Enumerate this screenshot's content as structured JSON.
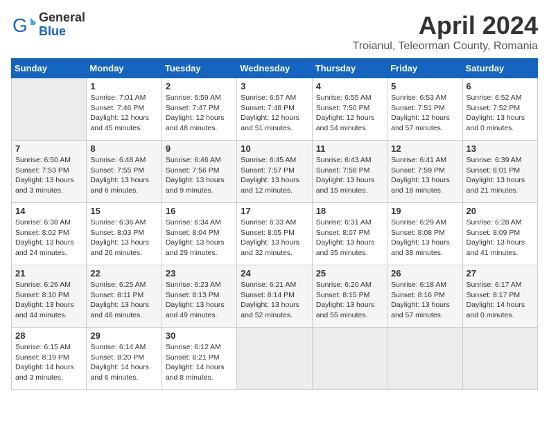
{
  "header": {
    "logo_general": "General",
    "logo_blue": "Blue",
    "month_year": "April 2024",
    "location": "Troianul, Teleorman County, Romania"
  },
  "weekdays": [
    "Sunday",
    "Monday",
    "Tuesday",
    "Wednesday",
    "Thursday",
    "Friday",
    "Saturday"
  ],
  "weeks": [
    [
      {
        "day": "",
        "info": ""
      },
      {
        "day": "1",
        "info": "Sunrise: 7:01 AM\nSunset: 7:46 PM\nDaylight: 12 hours\nand 45 minutes."
      },
      {
        "day": "2",
        "info": "Sunrise: 6:59 AM\nSunset: 7:47 PM\nDaylight: 12 hours\nand 48 minutes."
      },
      {
        "day": "3",
        "info": "Sunrise: 6:57 AM\nSunset: 7:48 PM\nDaylight: 12 hours\nand 51 minutes."
      },
      {
        "day": "4",
        "info": "Sunrise: 6:55 AM\nSunset: 7:50 PM\nDaylight: 12 hours\nand 54 minutes."
      },
      {
        "day": "5",
        "info": "Sunrise: 6:53 AM\nSunset: 7:51 PM\nDaylight: 12 hours\nand 57 minutes."
      },
      {
        "day": "6",
        "info": "Sunrise: 6:52 AM\nSunset: 7:52 PM\nDaylight: 13 hours\nand 0 minutes."
      }
    ],
    [
      {
        "day": "7",
        "info": "Sunrise: 6:50 AM\nSunset: 7:53 PM\nDaylight: 13 hours\nand 3 minutes."
      },
      {
        "day": "8",
        "info": "Sunrise: 6:48 AM\nSunset: 7:55 PM\nDaylight: 13 hours\nand 6 minutes."
      },
      {
        "day": "9",
        "info": "Sunrise: 6:46 AM\nSunset: 7:56 PM\nDaylight: 13 hours\nand 9 minutes."
      },
      {
        "day": "10",
        "info": "Sunrise: 6:45 AM\nSunset: 7:57 PM\nDaylight: 13 hours\nand 12 minutes."
      },
      {
        "day": "11",
        "info": "Sunrise: 6:43 AM\nSunset: 7:58 PM\nDaylight: 13 hours\nand 15 minutes."
      },
      {
        "day": "12",
        "info": "Sunrise: 6:41 AM\nSunset: 7:59 PM\nDaylight: 13 hours\nand 18 minutes."
      },
      {
        "day": "13",
        "info": "Sunrise: 6:39 AM\nSunset: 8:01 PM\nDaylight: 13 hours\nand 21 minutes."
      }
    ],
    [
      {
        "day": "14",
        "info": "Sunrise: 6:38 AM\nSunset: 8:02 PM\nDaylight: 13 hours\nand 24 minutes."
      },
      {
        "day": "15",
        "info": "Sunrise: 6:36 AM\nSunset: 8:03 PM\nDaylight: 13 hours\nand 26 minutes."
      },
      {
        "day": "16",
        "info": "Sunrise: 6:34 AM\nSunset: 8:04 PM\nDaylight: 13 hours\nand 29 minutes."
      },
      {
        "day": "17",
        "info": "Sunrise: 6:33 AM\nSunset: 8:05 PM\nDaylight: 13 hours\nand 32 minutes."
      },
      {
        "day": "18",
        "info": "Sunrise: 6:31 AM\nSunset: 8:07 PM\nDaylight: 13 hours\nand 35 minutes."
      },
      {
        "day": "19",
        "info": "Sunrise: 6:29 AM\nSunset: 8:08 PM\nDaylight: 13 hours\nand 38 minutes."
      },
      {
        "day": "20",
        "info": "Sunrise: 6:28 AM\nSunset: 8:09 PM\nDaylight: 13 hours\nand 41 minutes."
      }
    ],
    [
      {
        "day": "21",
        "info": "Sunrise: 6:26 AM\nSunset: 8:10 PM\nDaylight: 13 hours\nand 44 minutes."
      },
      {
        "day": "22",
        "info": "Sunrise: 6:25 AM\nSunset: 8:11 PM\nDaylight: 13 hours\nand 46 minutes."
      },
      {
        "day": "23",
        "info": "Sunrise: 6:23 AM\nSunset: 8:13 PM\nDaylight: 13 hours\nand 49 minutes."
      },
      {
        "day": "24",
        "info": "Sunrise: 6:21 AM\nSunset: 8:14 PM\nDaylight: 13 hours\nand 52 minutes."
      },
      {
        "day": "25",
        "info": "Sunrise: 6:20 AM\nSunset: 8:15 PM\nDaylight: 13 hours\nand 55 minutes."
      },
      {
        "day": "26",
        "info": "Sunrise: 6:18 AM\nSunset: 8:16 PM\nDaylight: 13 hours\nand 57 minutes."
      },
      {
        "day": "27",
        "info": "Sunrise: 6:17 AM\nSunset: 8:17 PM\nDaylight: 14 hours\nand 0 minutes."
      }
    ],
    [
      {
        "day": "28",
        "info": "Sunrise: 6:15 AM\nSunset: 8:19 PM\nDaylight: 14 hours\nand 3 minutes."
      },
      {
        "day": "29",
        "info": "Sunrise: 6:14 AM\nSunset: 8:20 PM\nDaylight: 14 hours\nand 6 minutes."
      },
      {
        "day": "30",
        "info": "Sunrise: 6:12 AM\nSunset: 8:21 PM\nDaylight: 14 hours\nand 8 minutes."
      },
      {
        "day": "",
        "info": ""
      },
      {
        "day": "",
        "info": ""
      },
      {
        "day": "",
        "info": ""
      },
      {
        "day": "",
        "info": ""
      }
    ]
  ]
}
